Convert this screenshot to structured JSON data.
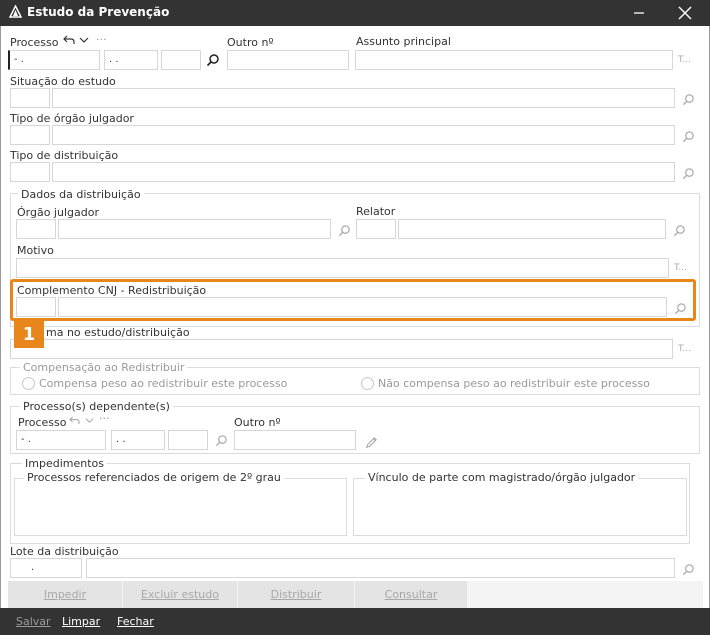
{
  "window": {
    "title": "Estudo da Prevenção"
  },
  "processo": {
    "label": "Processo",
    "num_value": "- .",
    "mid_value": ". .",
    "outro_label": "Outro nº",
    "assunto_label": "Assunto principal",
    "more": "···"
  },
  "situacao": {
    "label": "Situação do estudo"
  },
  "tipo_orgao": {
    "label": "Tipo de órgão julgador"
  },
  "tipo_distribuicao": {
    "label": "Tipo de distribuição"
  },
  "dados": {
    "legend": "Dados da distribuição",
    "orgao_label": "Órgão julgador",
    "relator_label": "Relator",
    "motivo_label": "Motivo",
    "complemento_label": "Complemento CNJ - Redistribuição"
  },
  "problema": {
    "label_rest": "ma no estudo/distribuição"
  },
  "annotation": {
    "badge": "1"
  },
  "compensacao": {
    "legend": "Compensação ao Redistribuir",
    "opt1": "Compensa peso ao redistribuir este processo",
    "opt2": "Não compensa peso ao redistribuir este processo"
  },
  "dependentes": {
    "legend": "Processo(s) dependente(s)",
    "processo_label": "Processo",
    "outro_label": "Outro nº",
    "num_value": "- .",
    "mid_value": ". .",
    "more": "···"
  },
  "impedimentos": {
    "legend": "Impedimentos",
    "left_legend": "Processos referenciados de origem de 2º grau",
    "right_legend": "Vínculo de parte com magistrado/órgão julgador"
  },
  "lote": {
    "label": "Lote da distribuição",
    "value": "."
  },
  "actions": {
    "impedir": "Impedir",
    "excluir": "Excluir estudo",
    "distribuir": "Distribuir",
    "consultar": "Consultar"
  },
  "footer": {
    "salvar": "Salvar",
    "limpar": "Limpar",
    "fechar": "Fechar"
  },
  "colors": {
    "titlebar": "#333333",
    "highlight": "#e8861b",
    "footer": "#333333"
  }
}
